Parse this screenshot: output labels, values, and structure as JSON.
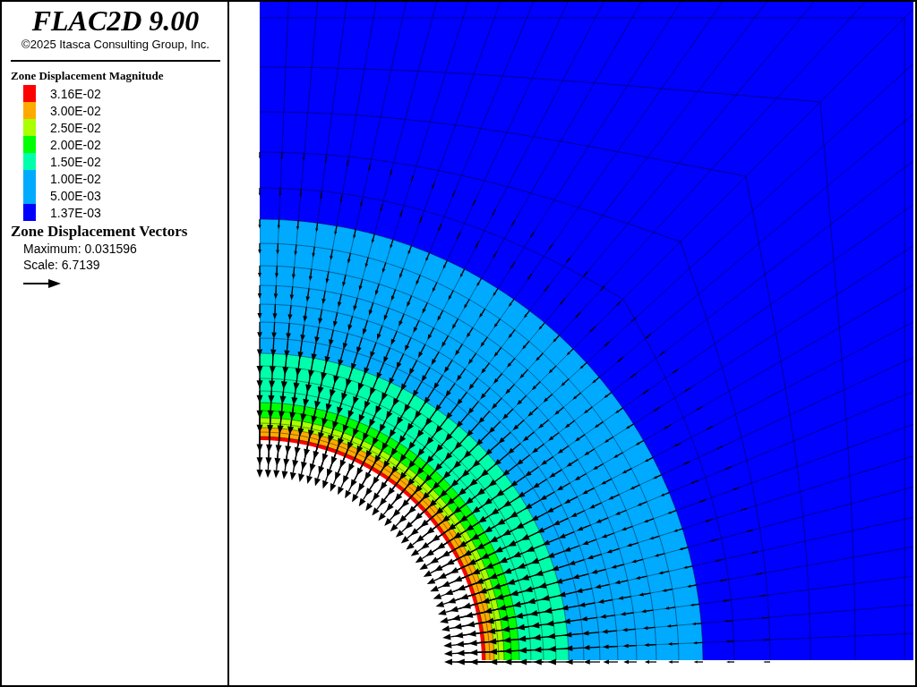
{
  "header": {
    "title": "FLAC2D 9.00",
    "copyright": "©2025 Itasca Consulting Group, Inc."
  },
  "legend": {
    "title": "Zone Displacement Magnitude",
    "items": [
      {
        "label": "3.16E-02",
        "color": "#ff0000"
      },
      {
        "label": "3.00E-02",
        "color": "#ffaa00"
      },
      {
        "label": "2.50E-02",
        "color": "#aaff00"
      },
      {
        "label": "2.00E-02",
        "color": "#00ff00"
      },
      {
        "label": "1.50E-02",
        "color": "#00ffaa"
      },
      {
        "label": "1.00E-02",
        "color": "#00aaff"
      },
      {
        "label": "5.00E-03",
        "color": "#00aaff"
      },
      {
        "label": "1.37E-03",
        "color": "#0000ff"
      }
    ]
  },
  "vectors": {
    "title": "Zone Displacement Vectors",
    "maximum": "Maximum: 0.031596",
    "scale": "Scale: 6.7139"
  }
}
